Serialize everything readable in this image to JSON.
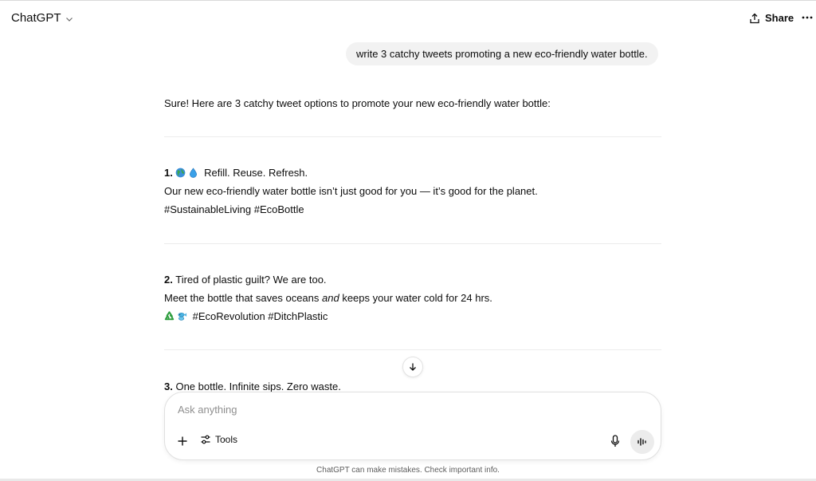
{
  "header": {
    "model_name": "ChatGPT",
    "share_label": "Share"
  },
  "conversation": {
    "user_message": "write 3 catchy tweets promoting a new eco-friendly water bottle.",
    "intro": "Sure! Here are 3 catchy tweet options to promote your new eco-friendly water bottle:",
    "tweets": [
      {
        "number": "1.",
        "line1": "Refill. Reuse. Refresh.",
        "line2": "Our new eco-friendly water bottle isn’t just good for you — it’s good for the planet.",
        "line3": "#SustainableLiving #EcoBottle",
        "emojis": [
          "globe-icon",
          "droplet-icon"
        ]
      },
      {
        "number": "2.",
        "line1": "Tired of plastic guilt? We are too.",
        "line2_before": "Meet the bottle that saves oceans ",
        "line2_em": "and",
        "line2_after": " keeps your water cold for 24 hrs.",
        "line3": "#EcoRevolution #DitchPlastic",
        "emojis": [
          "recycle-icon",
          "fish-icon"
        ]
      },
      {
        "number": "3.",
        "line1": "One bottle. Infinite sips. Zero waste."
      }
    ]
  },
  "composer": {
    "placeholder": "Ask anything",
    "tools_label": "Tools"
  },
  "footer": {
    "disclaimer": "ChatGPT can make mistakes. Check important info."
  }
}
